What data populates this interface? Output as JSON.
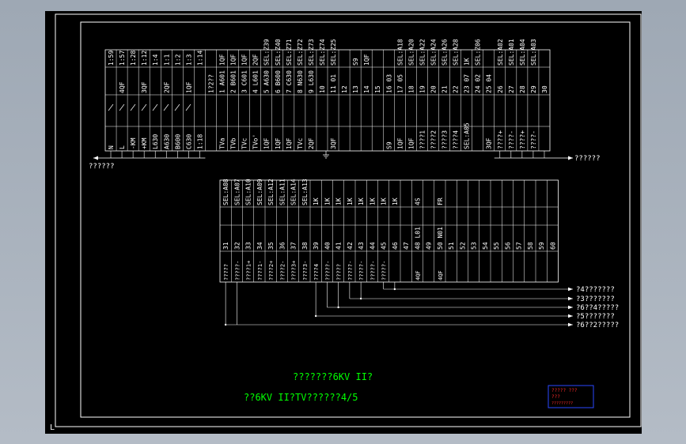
{
  "colors": {
    "window_bg": "#a8b1bc",
    "paper": "#000000",
    "line": "#ffffff",
    "text": "#ffffff",
    "note": "#00ff00",
    "stamp": "#ff2a2a",
    "stamp_frame": "#2a48ff"
  },
  "top_block": {
    "columns": [
      {
        "top": "1:59",
        "mid": "",
        "bot": "",
        "low": "N"
      },
      {
        "top": "1:57",
        "mid": "4QF",
        "bot": "",
        "low": "L"
      },
      {
        "top": "1:28",
        "mid": "",
        "bot": "",
        "low": "-KM"
      },
      {
        "top": "1:12",
        "mid": "3QF",
        "bot": "",
        "low": "+KM"
      },
      {
        "top": "1:4",
        "mid": "",
        "bot": "",
        "low": "L630"
      },
      {
        "top": "1:1",
        "mid": "2QF",
        "bot": "",
        "low": "A630"
      },
      {
        "top": "1:2",
        "mid": "",
        "bot": "",
        "low": "B600"
      },
      {
        "top": "1:3",
        "mid": "1QF",
        "bot": "",
        "low": "C630"
      },
      {
        "top": "1:14",
        "mid": "",
        "bot": "",
        "low": "1:18"
      },
      {
        "top": "",
        "mid": "1?2??",
        "bot": "",
        "low": ""
      },
      {
        "top": "1QF",
        "mid": "1 A601",
        "bot": "",
        "low": "TVa"
      },
      {
        "top": "1QF",
        "mid": "2 B601",
        "bot": "",
        "low": "TVb"
      },
      {
        "top": "1QF",
        "mid": "3 C601",
        "bot": "",
        "low": "TVc"
      },
      {
        "top": "2QF",
        "mid": "4 L601",
        "bot": "",
        "low": "TVo'"
      },
      {
        "top": "SEL:Z39",
        "mid": "5 A630",
        "bot": "",
        "low": "1QF"
      },
      {
        "top": "SEL:Z40",
        "mid": "6 B600",
        "bot": "",
        "low": "1QF"
      },
      {
        "top": "SEL:Z71",
        "mid": "7 C630",
        "bot": "",
        "low": "1QF"
      },
      {
        "top": "SEL:Z72",
        "mid": "8 N630",
        "bot": "",
        "low": "TVc"
      },
      {
        "top": "SEL:Z73",
        "mid": "9 L630",
        "bot": "",
        "low": "2QF"
      },
      {
        "top": "SEL:Z74",
        "mid": "10",
        "bot": "",
        "low": ""
      },
      {
        "top": "SEL:Z25",
        "mid": "11 01",
        "bot": "",
        "low": "3QF"
      },
      {
        "top": "",
        "mid": "12",
        "bot": "",
        "low": ""
      },
      {
        "top": "S9",
        "mid": "13",
        "bot": "",
        "low": ""
      },
      {
        "top": "1QF",
        "mid": "14",
        "bot": "",
        "low": ""
      },
      {
        "top": "",
        "mid": "15",
        "bot": "",
        "low": ""
      },
      {
        "top": "",
        "mid": "16 03",
        "bot": "",
        "low": "S9"
      },
      {
        "top": "SEL:A18",
        "mid": "17 05",
        "bot": "",
        "low": "1QF"
      },
      {
        "top": "SEL:A20",
        "mid": "18",
        "bot": "",
        "low": "1QF"
      },
      {
        "top": "SEL:A22",
        "mid": "19",
        "bot": "",
        "low": "????1"
      },
      {
        "top": "SEL:A24",
        "mid": "20",
        "bot": "",
        "low": "????2"
      },
      {
        "top": "SEL:A26",
        "mid": "21",
        "bot": "",
        "low": "????3"
      },
      {
        "top": "SEL:A28",
        "mid": "22",
        "bot": "",
        "low": "????4"
      },
      {
        "top": "1K",
        "mid": "23 07",
        "bot": "",
        "low": "SEL:A05"
      },
      {
        "top": "SEL:Z06",
        "mid": "24 02",
        "bot": "",
        "low": ""
      },
      {
        "top": "",
        "mid": "25 04",
        "bot": "",
        "low": "3QF"
      },
      {
        "top": "SEL:A02",
        "mid": "26",
        "bot": "",
        "low": "????+"
      },
      {
        "top": "SEL:A01",
        "mid": "27",
        "bot": "",
        "low": "????-"
      },
      {
        "top": "SEL:A04",
        "mid": "28",
        "bot": "",
        "low": "????+"
      },
      {
        "top": "SEL:A03",
        "mid": "29",
        "bot": "",
        "low": "????-"
      },
      {
        "top": "",
        "mid": "30",
        "bot": "",
        "low": ""
      }
    ],
    "left_arrow_label": "??????",
    "right_arrow_label": "??????"
  },
  "bottom_block": {
    "columns": [
      {
        "top": "SEL:A08",
        "num": "31",
        "low": "?????"
      },
      {
        "top": "SEL:A07",
        "num": "32",
        "low": "?????-"
      },
      {
        "top": "SEL:A10",
        "num": "33",
        "low": "????1+"
      },
      {
        "top": "SEL:A09",
        "num": "34",
        "low": "????1-"
      },
      {
        "top": "SEL:A12",
        "num": "35",
        "low": "????2+"
      },
      {
        "top": "SEL:A11",
        "num": "36",
        "low": "????2-"
      },
      {
        "top": "SEL:A14",
        "num": "37",
        "low": "????3+"
      },
      {
        "top": "SEL:A13",
        "num": "38",
        "low": "????3-"
      },
      {
        "top": "1K",
        "num": "39",
        "low": "????4"
      },
      {
        "top": "1K",
        "num": "40",
        "low": "?????-"
      },
      {
        "top": "1K",
        "num": "41",
        "low": "?????"
      },
      {
        "top": "1K",
        "num": "42",
        "low": "?????-"
      },
      {
        "top": "1K",
        "num": "43",
        "low": "?????-"
      },
      {
        "top": "1K",
        "num": "44",
        "low": "?????-"
      },
      {
        "top": "1K",
        "num": "45",
        "low": "?????-"
      },
      {
        "top": "1K",
        "num": "46",
        "low": ""
      },
      {
        "top": "",
        "num": "47",
        "low": ""
      },
      {
        "top": "4S",
        "num": "48 L01",
        "low": "4QF"
      },
      {
        "top": "",
        "num": "49",
        "low": ""
      },
      {
        "top": "FR",
        "num": "50 N01",
        "low": "4QF"
      },
      {
        "top": "",
        "num": "51",
        "low": ""
      },
      {
        "top": "",
        "num": "52",
        "low": ""
      },
      {
        "top": "",
        "num": "53",
        "low": ""
      },
      {
        "top": "",
        "num": "54",
        "low": ""
      },
      {
        "top": "",
        "num": "55",
        "low": ""
      },
      {
        "top": "",
        "num": "56",
        "low": ""
      },
      {
        "top": "",
        "num": "57",
        "low": ""
      },
      {
        "top": "",
        "num": "58",
        "low": ""
      },
      {
        "top": "",
        "num": "59",
        "low": ""
      },
      {
        "top": "",
        "num": "60",
        "low": ""
      }
    ],
    "outputs": [
      "?4???????",
      "?3???????",
      "?6??4?????",
      "?5???????",
      "?6??2?????"
    ]
  },
  "notes": {
    "line1": "???????6KV II?",
    "line2": "??6KV II?TV??????4/5"
  },
  "stamp": {
    "line1": "????? ???",
    "line2": "???",
    "line3": "?????????"
  },
  "corner_mark": "L"
}
